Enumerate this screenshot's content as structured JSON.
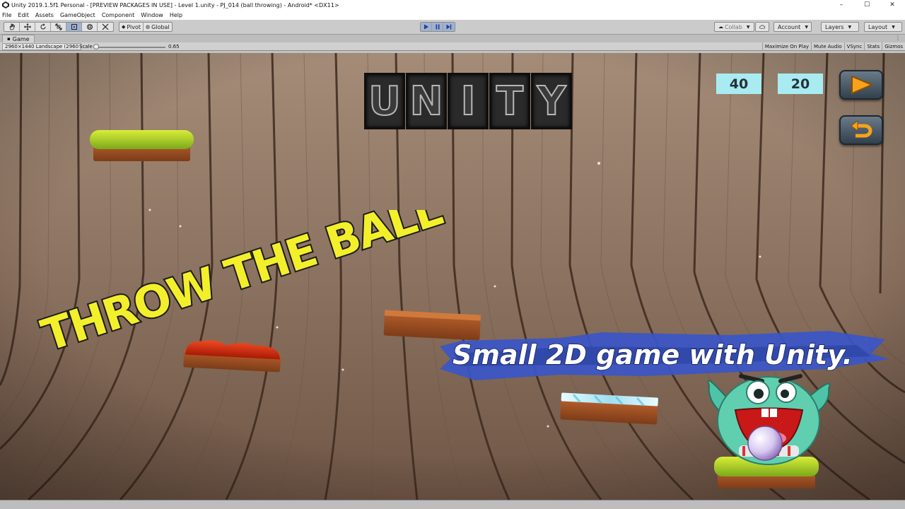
{
  "window": {
    "title": "Unity 2019.1.5f1 Personal - [PREVIEW PACKAGES IN USE] - Level 1.unity - PJ_014 (ball throwing) - Android* <DX11>",
    "minimize": "–",
    "maximize": "☐",
    "close": "✕"
  },
  "menu": [
    "File",
    "Edit",
    "Assets",
    "GameObject",
    "Component",
    "Window",
    "Help"
  ],
  "toolbar": {
    "pivot": "Pivot",
    "global": "Global",
    "collab": "Collab",
    "account": "Account",
    "layers": "Layers",
    "layout": "Layout"
  },
  "game_tab": {
    "label": "Game",
    "resolution": "2960×1440 Landscape (2960",
    "scale_label": "Scale",
    "scale_value": "0.65",
    "scale_fraction": 0.02,
    "buttons": [
      "Maximize On Play",
      "Mute Audio",
      "VSync",
      "Stats",
      "Gizmos"
    ]
  },
  "game": {
    "score_left": "40",
    "score_right": "20",
    "logo_letters": [
      "U",
      "N",
      "I",
      "T",
      "Y"
    ],
    "headline": "THROW THE BALL",
    "subtitle": "Small 2D game with Unity.",
    "icons": [
      "play-icon",
      "restart-icon"
    ]
  },
  "colors": {
    "hud_box": "#a8ecf2",
    "headline_fill": "#f3ef2b",
    "banner_blue": "#3a56c8",
    "wood": "#8e7563"
  }
}
